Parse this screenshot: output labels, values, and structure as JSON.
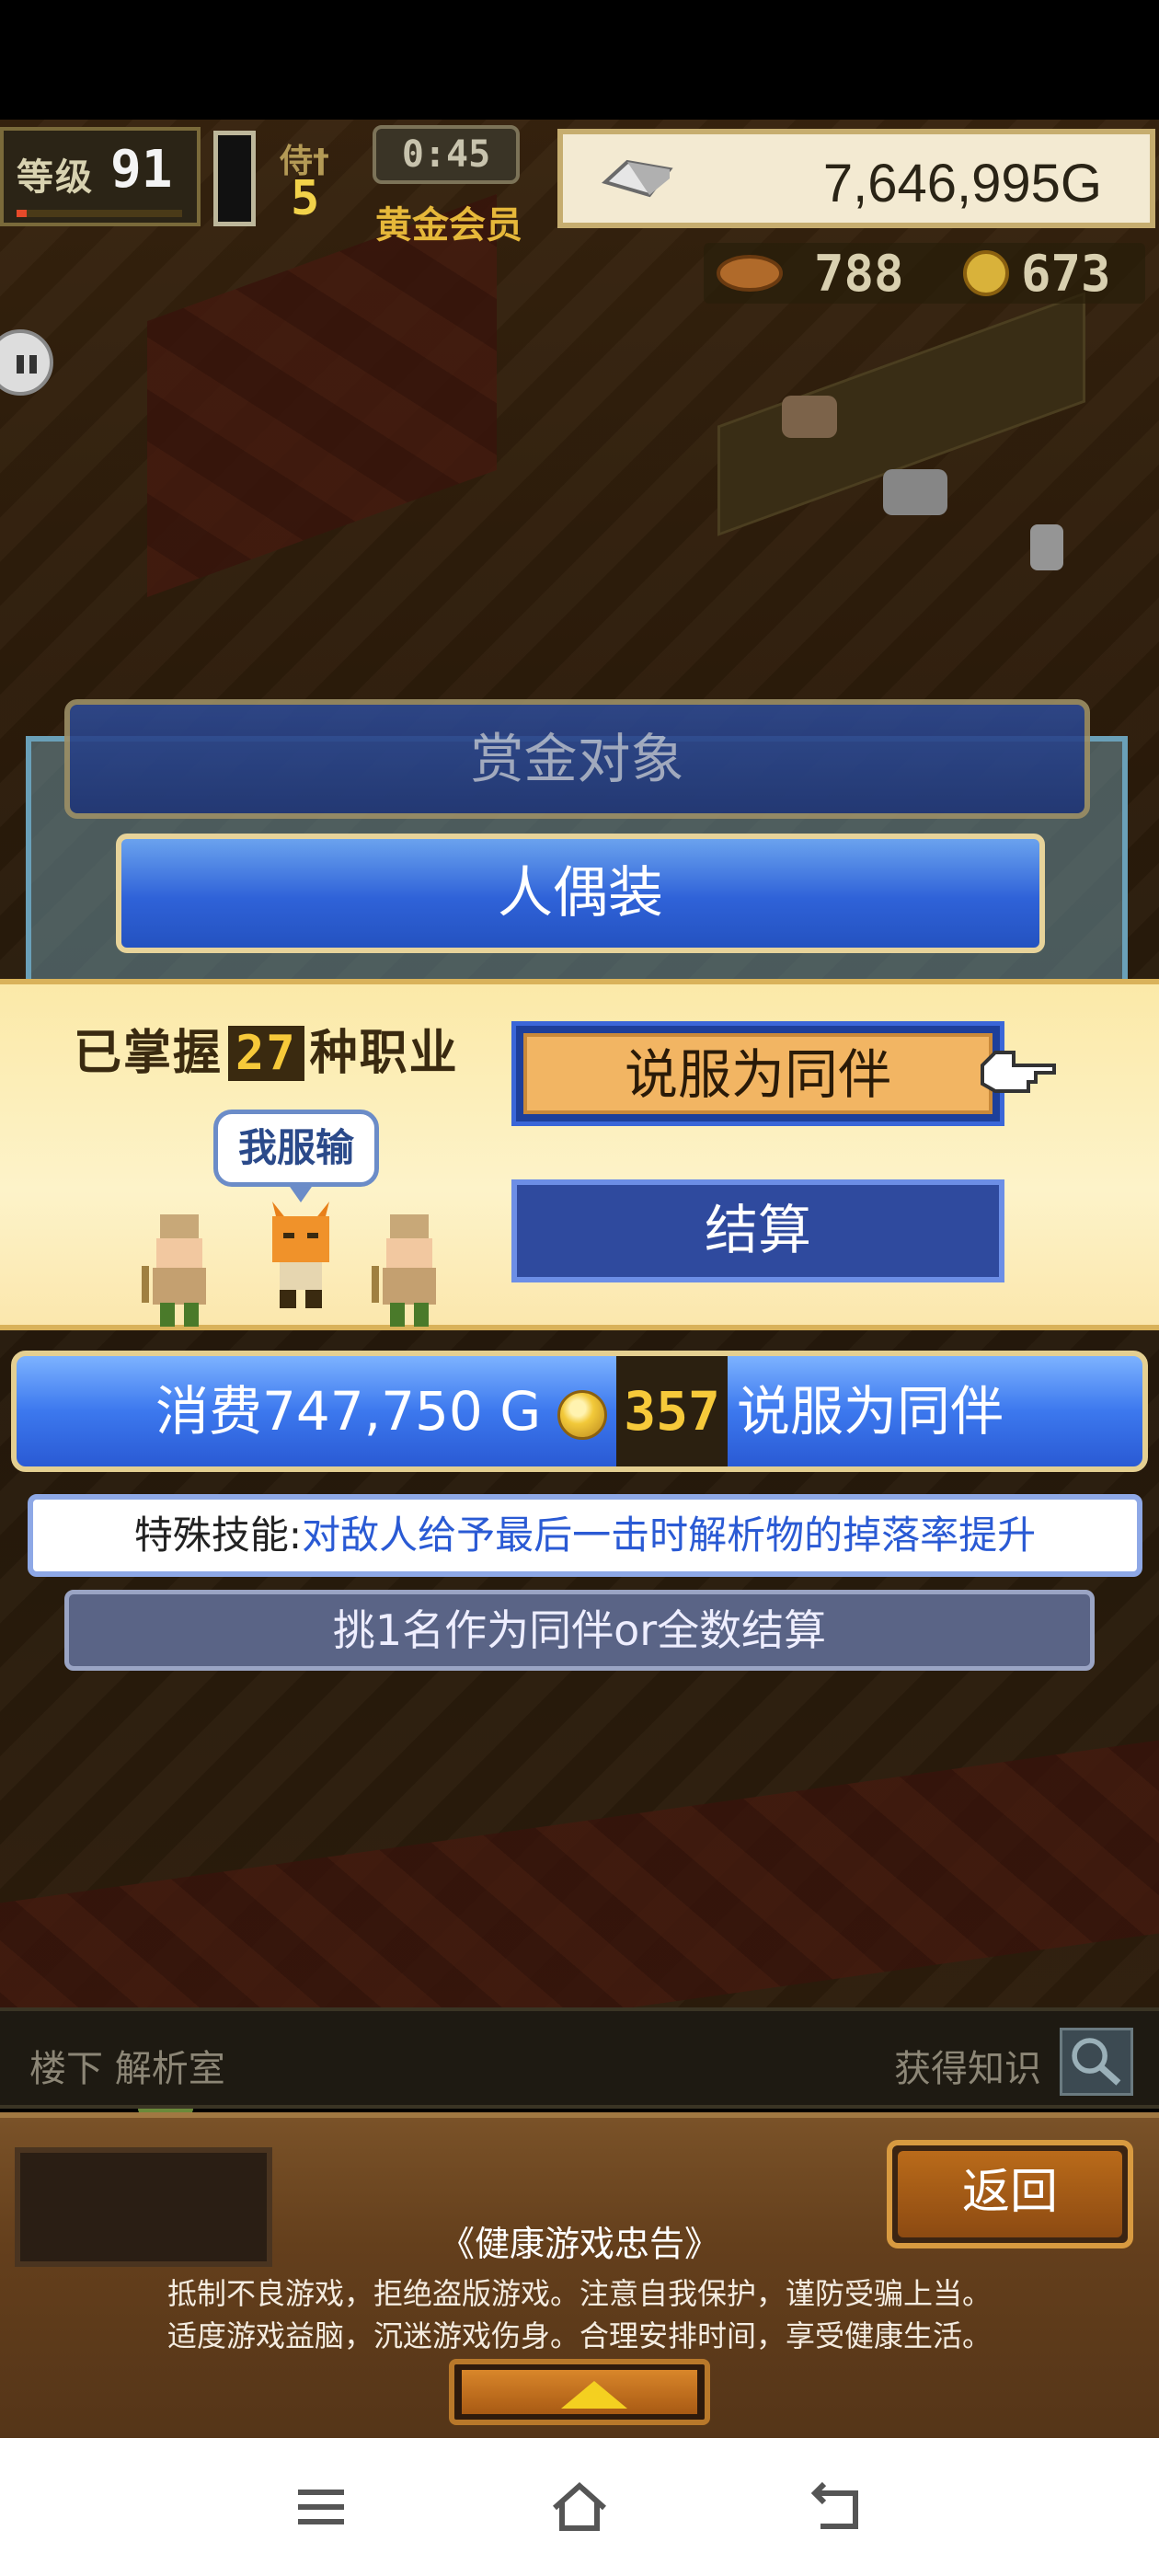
{
  "hud": {
    "level_label": "等级",
    "level_value": "91",
    "level_progress": 0.06,
    "rank_label": "侍†",
    "rank_value": "5",
    "timer": "0:45",
    "membership": "黄金会员",
    "gold": "7,646,995G",
    "resource_1": "788",
    "resource_2": "673"
  },
  "dialog": {
    "title": "赏金对象",
    "target_name": "人偶装",
    "jobs_prefix": "已掌握",
    "jobs_count": "27",
    "jobs_suffix": "种职业",
    "speech": "我服输",
    "persuade_label": "说服为同伴",
    "settle_label": "结算",
    "cost_prefix": "消费747,750 G",
    "medal_count": "357",
    "cost_suffix": "说服为同伴",
    "skill_label": "特殊技能:",
    "skill_text": "对敌人给予最后一击时解析物的掉落率提升",
    "hint": "挑1名作为同伴or全数结算"
  },
  "location": {
    "floor": "楼下 解析室",
    "action": "获得知识"
  },
  "bottom": {
    "back_label": "返回",
    "health_title": "《健康游戏忠告》",
    "health_line1": "抵制不良游戏，拒绝盗版游戏。注意自我保护，谨防受骗上当。",
    "health_line2": "适度游戏益脑，沉迷游戏伤身。合理安排时间，享受健康生活。"
  },
  "icons": {
    "gold": "gold-bar-icon",
    "coin": "coin-icon",
    "pointer": "hand-pointer-icon",
    "magnifier": "magnifier-icon"
  },
  "colors": {
    "accent_blue": "#2f62d8",
    "panel_yellow": "#fdf3c9",
    "persuade_orange": "#f2b563"
  }
}
